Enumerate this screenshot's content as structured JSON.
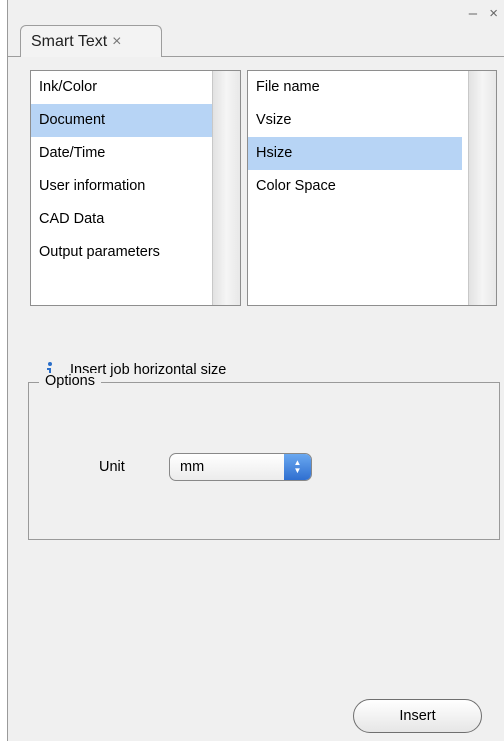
{
  "window": {
    "tab_label": "Smart Text",
    "tab_close": "×",
    "controls": "– ×"
  },
  "categories": {
    "items": [
      "Ink/Color",
      "Document",
      "Date/Time",
      "User information",
      "CAD Data",
      "Output parameters"
    ],
    "selected": "Document"
  },
  "fields": {
    "items": [
      "File name",
      "Vsize",
      "Hsize",
      "Color Space"
    ],
    "selected": "Hsize"
  },
  "info": {
    "icon": "info-icon",
    "text": "Insert job horizontal size"
  },
  "options": {
    "legend": "Options",
    "unit_label": "Unit",
    "unit_value": "mm"
  },
  "actions": {
    "insert_label": "Insert"
  },
  "colors": {
    "selection": "#b7d4f5",
    "select_arrow": "#2f6fd0"
  }
}
